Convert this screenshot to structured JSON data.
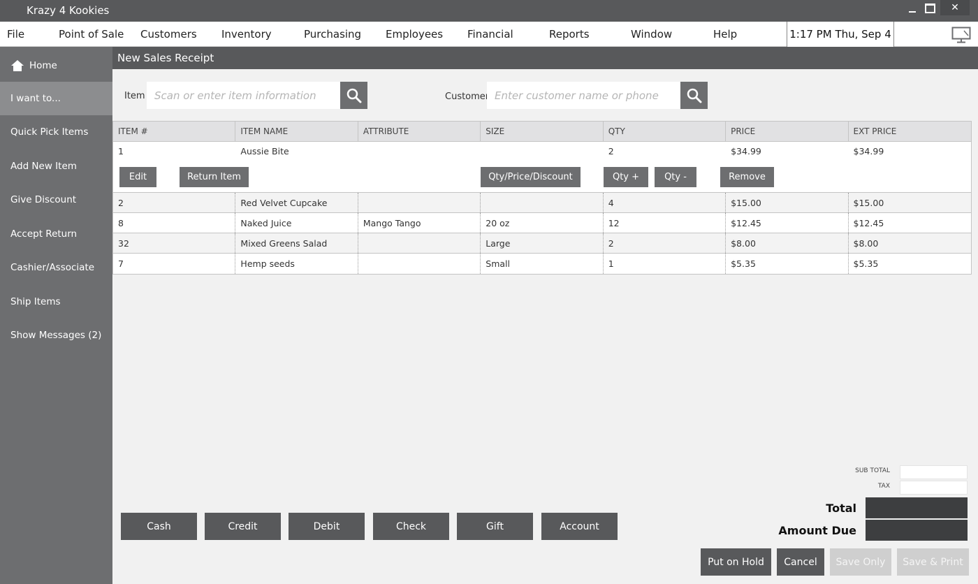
{
  "app": {
    "title": "Krazy 4 Kookies",
    "close_label": "✕"
  },
  "menu": [
    "File",
    "Point of Sale",
    "Customers",
    "Inventory",
    "Purchasing",
    "Employees",
    "Financial",
    "Reports",
    "Window",
    "Help"
  ],
  "clock": "1:17 PM Thu, Sep 4",
  "sidebar": [
    {
      "label": "Home",
      "icon": "home-icon"
    },
    {
      "label": "I want to..."
    },
    {
      "label": "Quick Pick Items"
    },
    {
      "label": "Add New Item"
    },
    {
      "label": "Give Discount"
    },
    {
      "label": "Accept Return"
    },
    {
      "label": "Cashier/Associate"
    },
    {
      "label": "Ship Items"
    },
    {
      "label": "Show Messages (2)"
    }
  ],
  "page_title": "New Sales Receipt",
  "search": {
    "item_label": "Item",
    "item_placeholder": "Scan or enter item information",
    "customer_label": "Customer",
    "customer_placeholder": "Enter customer name or phone"
  },
  "table": {
    "columns": [
      "ITEM #",
      "ITEM NAME",
      "ATTRIBUTE",
      "SIZE",
      "QTY",
      "PRICE",
      "EXT PRICE"
    ],
    "selected_row": [
      "1",
      "Aussie Bite",
      "",
      "",
      "2",
      "$34.99",
      "$34.99"
    ],
    "row_actions": [
      "Edit",
      "Return Item",
      "Qty/Price/Discount",
      "Qty +",
      "Qty -",
      "Remove"
    ],
    "rows": [
      [
        "2",
        "Red Velvet Cupcake",
        "",
        "",
        "4",
        "$15.00",
        "$15.00"
      ],
      [
        "8",
        "Naked Juice",
        "Mango Tango",
        "20 oz",
        "12",
        "$12.45",
        "$12.45"
      ],
      [
        "32",
        "Mixed Greens Salad",
        "",
        "Large",
        "2",
        "$8.00",
        "$8.00"
      ],
      [
        "7",
        "Hemp seeds",
        "",
        "Small",
        "1",
        "$5.35",
        "$5.35"
      ]
    ]
  },
  "totals": {
    "subtotal_label": "SUB TOTAL",
    "tax_label": "TAX",
    "total_label": "Total",
    "amount_due_label": "Amount Due"
  },
  "tenders": [
    "Cash",
    "Credit",
    "Debit",
    "Check",
    "Gift",
    "Account"
  ],
  "bottom_buttons": {
    "hold": "Put on Hold",
    "cancel": "Cancel",
    "save_only": "Save Only",
    "save_print": "Save & Print"
  }
}
